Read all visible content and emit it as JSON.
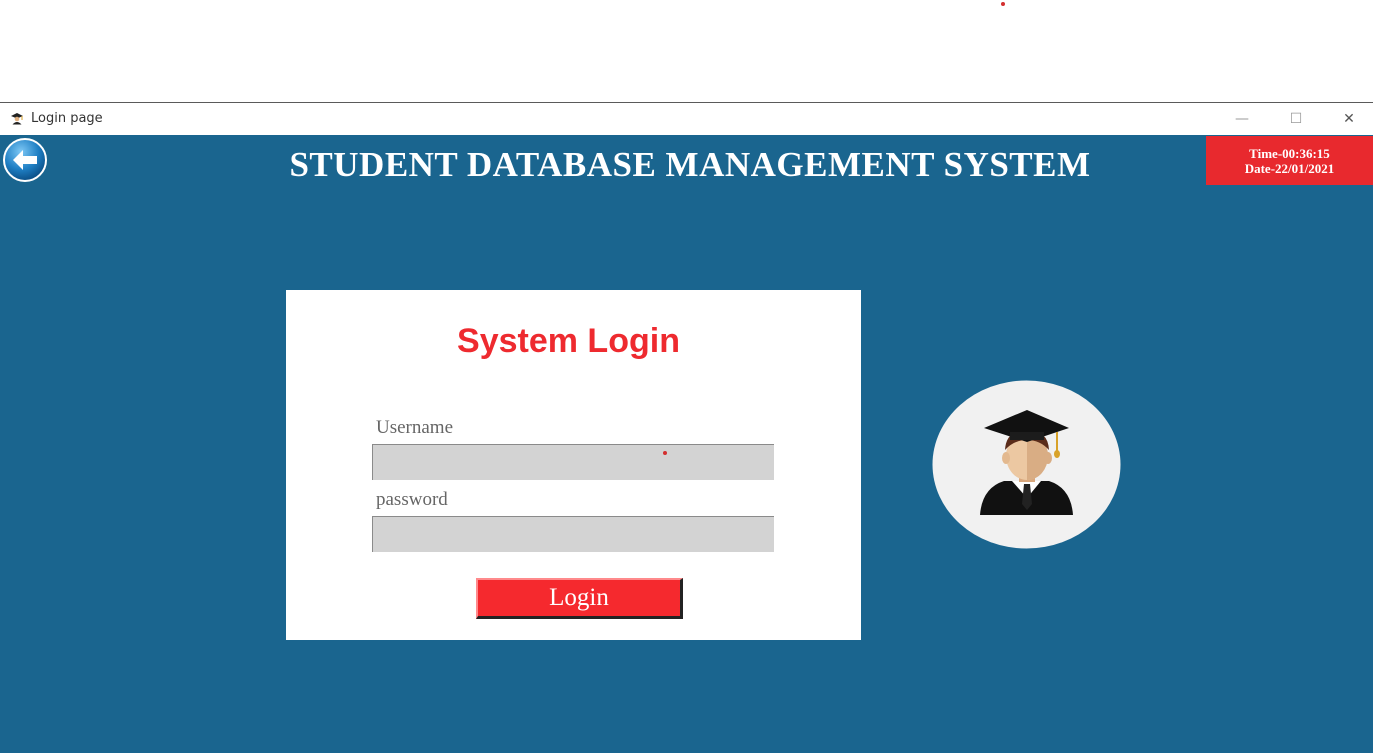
{
  "window": {
    "title": "Login page",
    "minimize_glyph": "—",
    "maximize_glyph": "☐",
    "close_glyph": "✕"
  },
  "header": {
    "title": "STUDENT DATABASE MANAGEMENT SYSTEM",
    "back_icon": "back-arrow-icon"
  },
  "clock": {
    "time": "Time-00:36:15",
    "date": "Date-22/01/2021"
  },
  "login": {
    "title": "System Login",
    "username_label": "Username",
    "username_value": "",
    "password_label": "password",
    "password_value": "",
    "button_label": "Login"
  },
  "colors": {
    "background": "#1a658f",
    "accent_red": "#ee2a2f",
    "input_gray": "#d3d3d3"
  },
  "icons": {
    "avatar": "graduate-avatar-icon",
    "app_icon": "graduate-cap-icon"
  }
}
